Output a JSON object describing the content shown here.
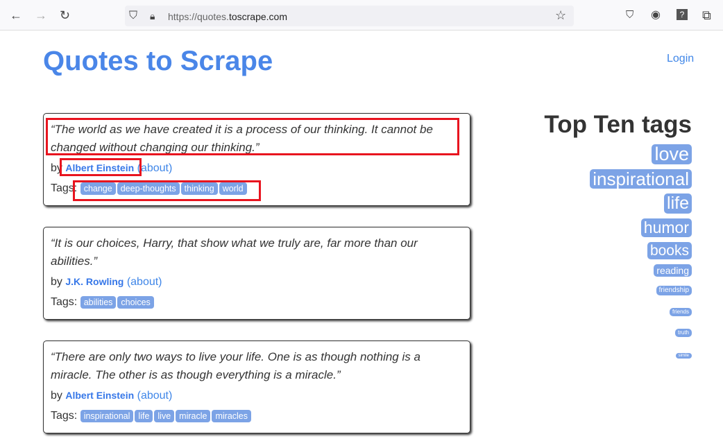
{
  "browser": {
    "url_prefix": "https://quotes.",
    "url_domain": "toscrape.com"
  },
  "header": {
    "title": "Quotes to Scrape",
    "login": "Login"
  },
  "labels": {
    "by": "by",
    "about": "(about)",
    "tags": "Tags:"
  },
  "quotes": [
    {
      "text": "“The world as we have created it is a process of our thinking. It cannot be changed without changing our thinking.”",
      "author": "Albert Einstein",
      "tags": [
        "change",
        "deep-thoughts",
        "thinking",
        "world"
      ]
    },
    {
      "text": "“It is our choices, Harry, that show what we truly are, far more than our abilities.”",
      "author": "J.K. Rowling",
      "tags": [
        "abilities",
        "choices"
      ]
    },
    {
      "text": "“There are only two ways to live your life. One is as though nothing is a miracle. The other is as though everything is a miracle.”",
      "author": "Albert Einstein",
      "tags": [
        "inspirational",
        "life",
        "live",
        "miracle",
        "miracles"
      ]
    }
  ],
  "sidebar": {
    "heading": "Top Ten tags",
    "tags": [
      "love",
      "inspirational",
      "life",
      "humor",
      "books",
      "reading",
      "friendship",
      "friends",
      "truth",
      "simile"
    ]
  }
}
